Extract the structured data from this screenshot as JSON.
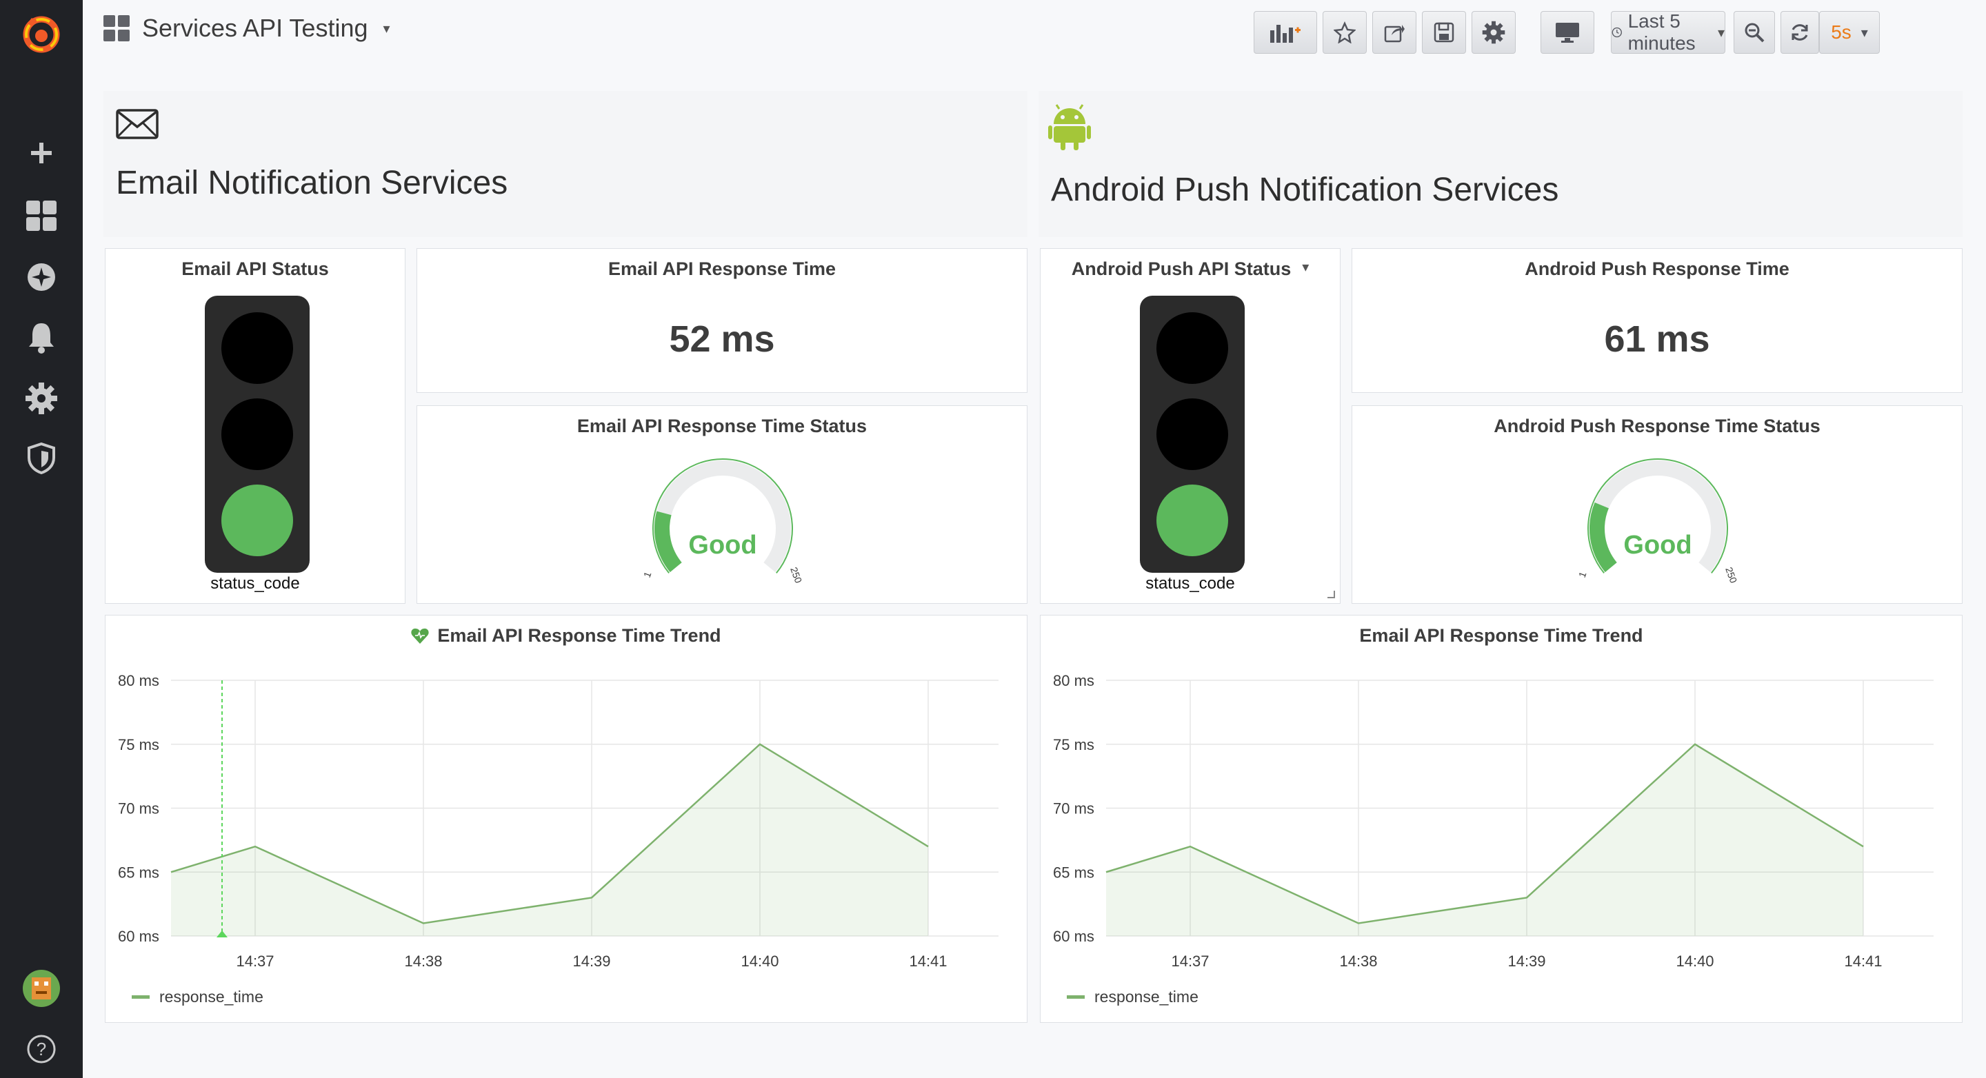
{
  "navbar": {
    "dashboard_title": "Services API Testing",
    "time_range": "Last 5 minutes",
    "refresh_interval": "5s"
  },
  "colors": {
    "accent_orange": "#eb7b18",
    "ok_green": "#5cb85c",
    "series_green": "#7eb26d",
    "sidebar_bg": "#202226"
  },
  "icons": {
    "sidebar": [
      "grafana-logo-icon",
      "plus-icon",
      "dashboards-icon",
      "explore-icon",
      "bell-icon",
      "gear-icon",
      "shield-icon",
      "avatar",
      "help-icon"
    ],
    "navbar": [
      "add-panel-icon",
      "star-icon",
      "share-icon",
      "save-icon",
      "settings-icon",
      "tv-icon",
      "clock-icon",
      "zoom-out-icon",
      "refresh-icon"
    ]
  },
  "email_section": {
    "title": "Email Notification Services",
    "icon": "envelope-icon",
    "status_panel": {
      "title": "Email API Status",
      "label": "status_code",
      "active_light": "green"
    },
    "response_panel": {
      "title": "Email API Response Time",
      "value": "52 ms"
    },
    "gauge_panel": {
      "title": "Email API Response Time Status",
      "value_text": "Good",
      "min_label": "1",
      "max_label": "250",
      "level_fraction": 0.21
    },
    "trend_panel": {
      "title": "Email API Response Time Trend",
      "legend": "response_time"
    }
  },
  "android_section": {
    "title": "Android Push Notification Services",
    "icon": "android-icon",
    "status_panel": {
      "title": "Android Push API Status",
      "label": "status_code",
      "active_light": "green"
    },
    "response_panel": {
      "title": "Android Push Response Time",
      "value": "61 ms"
    },
    "gauge_panel": {
      "title": "Android Push Response Time Status",
      "value_text": "Good",
      "min_label": "1",
      "max_label": "250",
      "level_fraction": 0.24
    },
    "trend_panel": {
      "title": "Email API Response Time Trend",
      "legend": "response_time"
    }
  },
  "chart_data": [
    {
      "type": "area",
      "title": "Email API Response Time Trend",
      "x": [
        "14:36:30",
        "14:37",
        "14:37:30",
        "14:38",
        "14:38:30",
        "14:39",
        "14:39:30",
        "14:40",
        "14:40:30",
        "14:41"
      ],
      "x_ticks": [
        "14:37",
        "14:38",
        "14:39",
        "14:40",
        "14:41"
      ],
      "y_ticks": [
        "60 ms",
        "65 ms",
        "70 ms",
        "75 ms",
        "80 ms"
      ],
      "ylim": [
        60,
        80
      ],
      "unit": "ms",
      "series": [
        {
          "name": "response_time",
          "values": [
            65,
            67,
            64,
            61,
            62,
            63,
            69,
            75,
            71,
            67
          ]
        }
      ],
      "grid": true,
      "legend": "bottom-left"
    },
    {
      "type": "area",
      "title": "Email API Response Time Trend",
      "x": [
        "14:36:30",
        "14:37",
        "14:37:30",
        "14:38",
        "14:38:30",
        "14:39",
        "14:39:30",
        "14:40",
        "14:40:30",
        "14:41"
      ],
      "x_ticks": [
        "14:37",
        "14:38",
        "14:39",
        "14:40",
        "14:41"
      ],
      "y_ticks": [
        "60 ms",
        "65 ms",
        "70 ms",
        "75 ms",
        "80 ms"
      ],
      "ylim": [
        60,
        80
      ],
      "unit": "ms",
      "series": [
        {
          "name": "response_time",
          "values": [
            65,
            67,
            64,
            61,
            62,
            63,
            69,
            75,
            71,
            67
          ]
        }
      ],
      "grid": true,
      "legend": "bottom-left"
    }
  ]
}
